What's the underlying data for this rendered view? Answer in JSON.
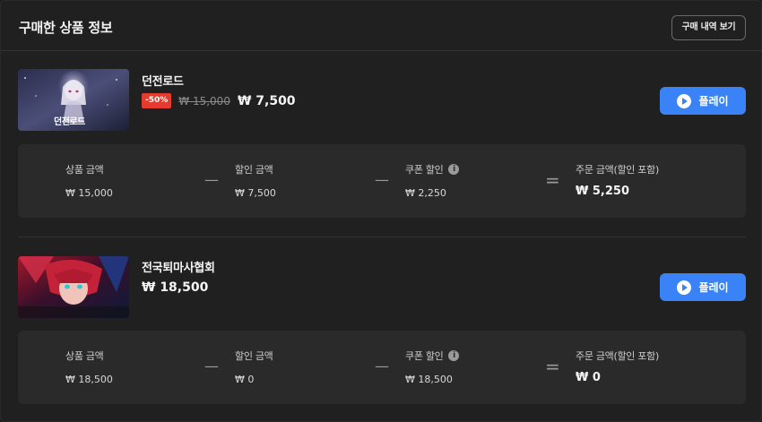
{
  "header": {
    "title": "구매한 상품 정보",
    "history_button": "구매 내역 보기"
  },
  "products": [
    {
      "title": "던전로드",
      "thumb_text": "던전로드",
      "discount": "-50%",
      "original_price": "₩ 15,000",
      "final_price": "₩ 7,500",
      "play_label": "플레이",
      "breakdown": {
        "product_amount_label": "상품 금액",
        "product_amount": "₩ 15,000",
        "discount_amount_label": "할인 금액",
        "discount_amount": "₩ 7,500",
        "coupon_label": "쿠폰 할인",
        "coupon_amount": "₩ 2,250",
        "order_amount_label": "주문 금액(할인 포함)",
        "order_amount": "₩ 5,250",
        "minus": "—",
        "equals": "="
      }
    },
    {
      "title": "전국퇴마사협회",
      "final_price": "₩ 18,500",
      "play_label": "플레이",
      "breakdown": {
        "product_amount_label": "상품 금액",
        "product_amount": "₩ 18,500",
        "discount_amount_label": "할인 금액",
        "discount_amount": "₩ 0",
        "coupon_label": "쿠폰 할인",
        "coupon_amount": "₩ 18,500",
        "order_amount_label": "주문 금액(할인 포함)",
        "order_amount": "₩ 0",
        "minus": "—",
        "equals": "="
      }
    }
  ],
  "icons": {
    "info": "i",
    "play": "play-icon"
  },
  "colors": {
    "accent": "#3a82f7",
    "discount_badge": "#e53a2e",
    "background": "#202020",
    "card": "#2a2a2a"
  }
}
